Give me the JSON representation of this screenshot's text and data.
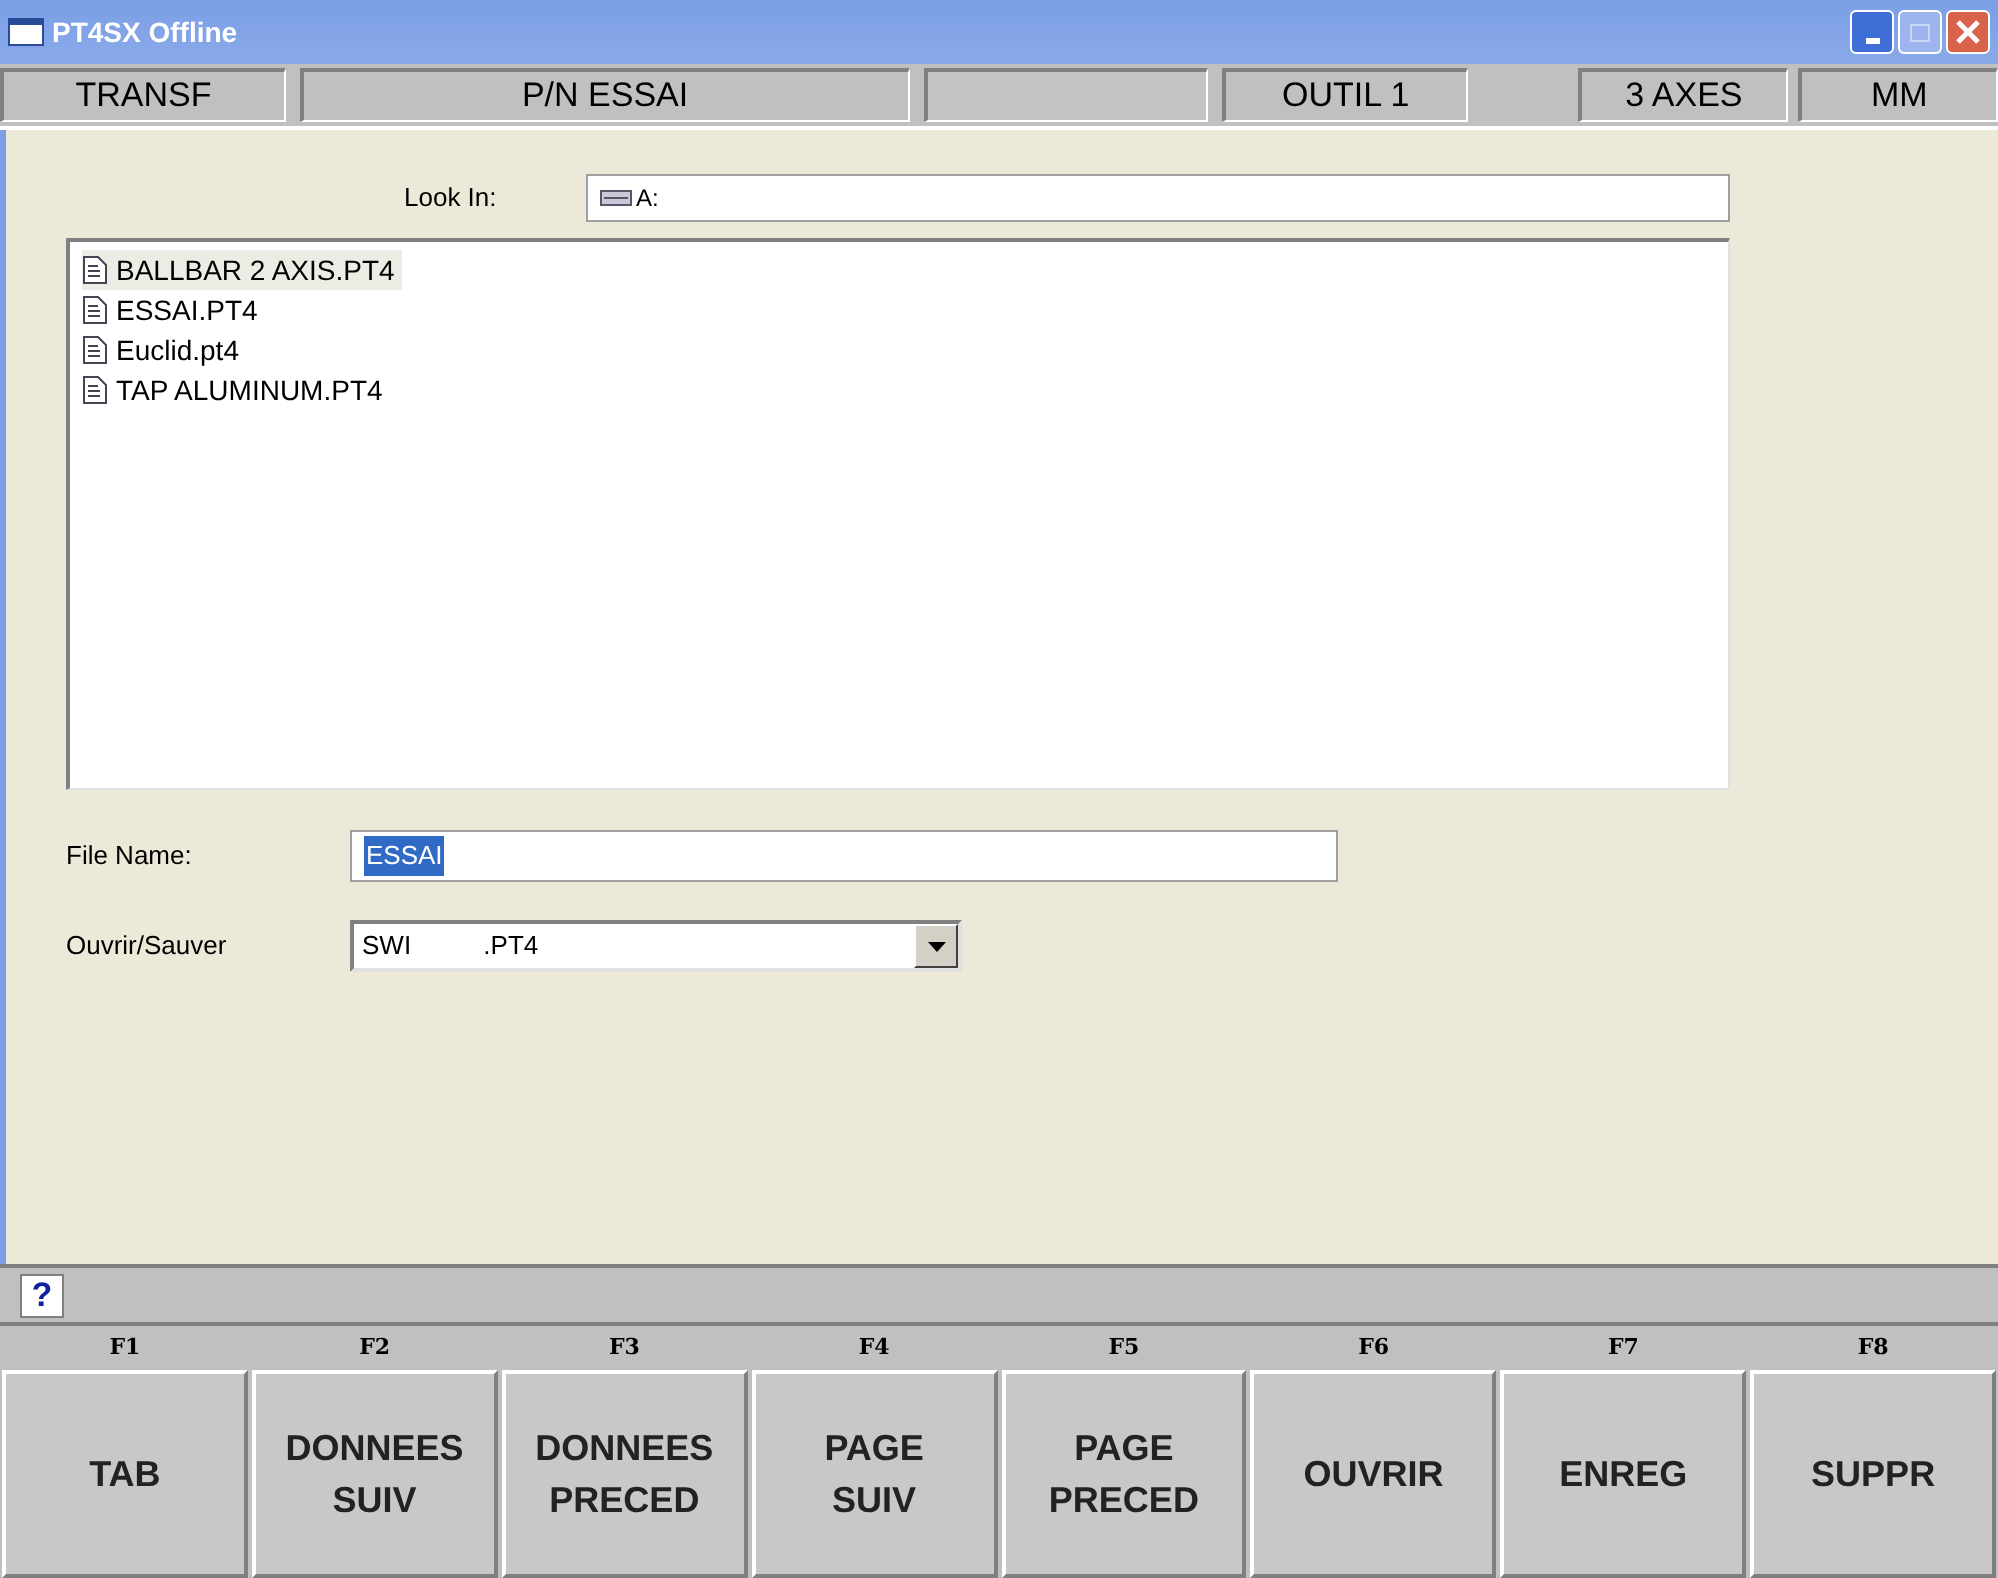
{
  "window": {
    "title": "PT4SX Offline"
  },
  "status_bar": [
    {
      "kind": "label",
      "text": "TRANSF"
    },
    {
      "kind": "label",
      "text": "P/N ESSAI"
    },
    {
      "kind": "blank"
    },
    {
      "kind": "label",
      "text": "OUTIL 1"
    },
    {
      "kind": "label",
      "text": "3 AXES"
    },
    {
      "kind": "label",
      "text": "MM"
    }
  ],
  "look_in": {
    "label": "Look In:",
    "value": "A:"
  },
  "files": [
    {
      "name": "BALLBAR 2 AXIS.PT4",
      "selected": true
    },
    {
      "name": "ESSAI.PT4",
      "selected": false
    },
    {
      "name": "Euclid.pt4",
      "selected": false
    },
    {
      "name": "TAP ALUMINUM.PT4",
      "selected": false
    }
  ],
  "file_name": {
    "label": "File Name:",
    "value": "ESSAI"
  },
  "file_type": {
    "label": "Ouvrir/Sauver",
    "value": "SWI          .PT4"
  },
  "help": {
    "text": "?"
  },
  "function_keys": [
    {
      "key": "F1",
      "label": "TAB"
    },
    {
      "key": "F2",
      "label": "DONNEES\nSUIV"
    },
    {
      "key": "F3",
      "label": "DONNEES\nPRECED"
    },
    {
      "key": "F4",
      "label": "PAGE\nSUIV"
    },
    {
      "key": "F5",
      "label": "PAGE\nPRECED"
    },
    {
      "key": "F6",
      "label": "OUVRIR"
    },
    {
      "key": "F7",
      "label": "ENREG"
    },
    {
      "key": "F8",
      "label": "SUPPR"
    }
  ]
}
